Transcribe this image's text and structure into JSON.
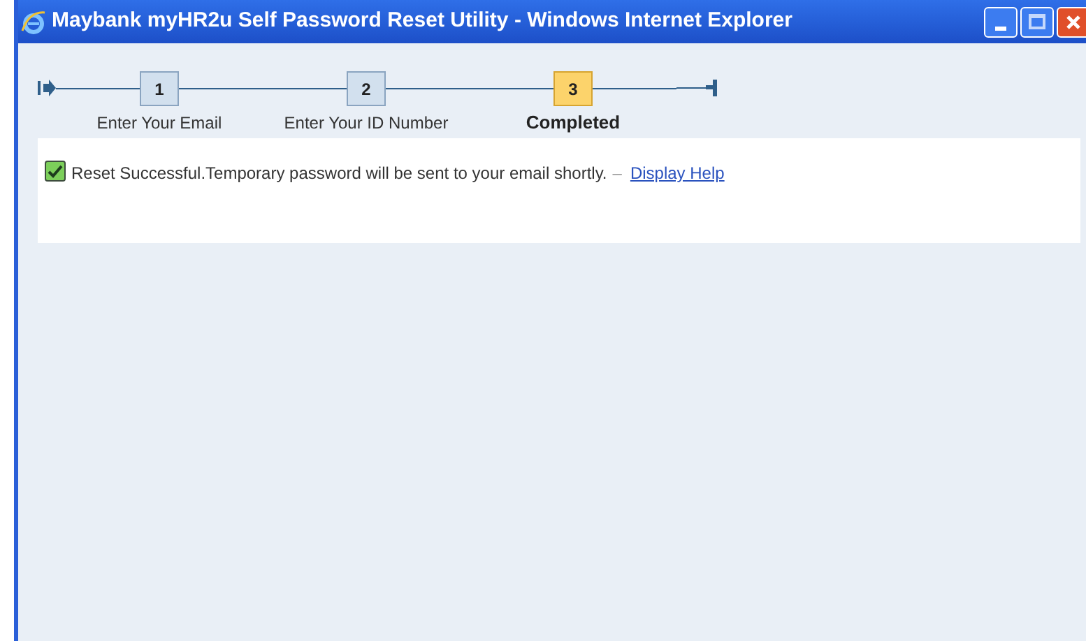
{
  "window": {
    "title": "Maybank myHR2u Self Password Reset Utility - Windows Internet Explorer"
  },
  "steps": [
    {
      "number": "1",
      "label": "Enter Your Email",
      "selected": false
    },
    {
      "number": "2",
      "label": "Enter Your ID Number",
      "selected": false
    },
    {
      "number": "3",
      "label": "Completed",
      "selected": true
    }
  ],
  "message": {
    "checked": true,
    "text": "Reset Successful.Temporary password will be sent to your email shortly.",
    "separator": "–",
    "link": "Display Help"
  }
}
